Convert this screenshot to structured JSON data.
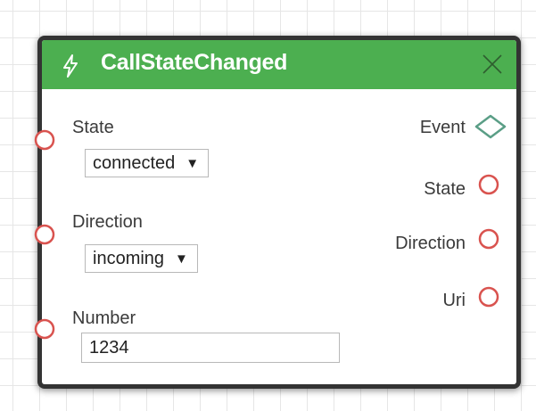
{
  "node": {
    "title": "CallStateChanged",
    "header_color": "#4caf50",
    "header_icon": "lightning-bolt-icon",
    "close_icon": "close-icon",
    "port_color": "#d9534f",
    "event_port_color": "#5a9e86"
  },
  "inputs": [
    {
      "label": "State",
      "type": "select",
      "value": "connected"
    },
    {
      "label": "Direction",
      "type": "select",
      "value": "incoming"
    },
    {
      "label": "Number",
      "type": "text",
      "value": "1234"
    }
  ],
  "outputs": [
    {
      "label": "Event",
      "shape": "diamond"
    },
    {
      "label": "State",
      "shape": "circle"
    },
    {
      "label": "Direction",
      "shape": "circle"
    },
    {
      "label": "Uri",
      "shape": "circle"
    }
  ]
}
